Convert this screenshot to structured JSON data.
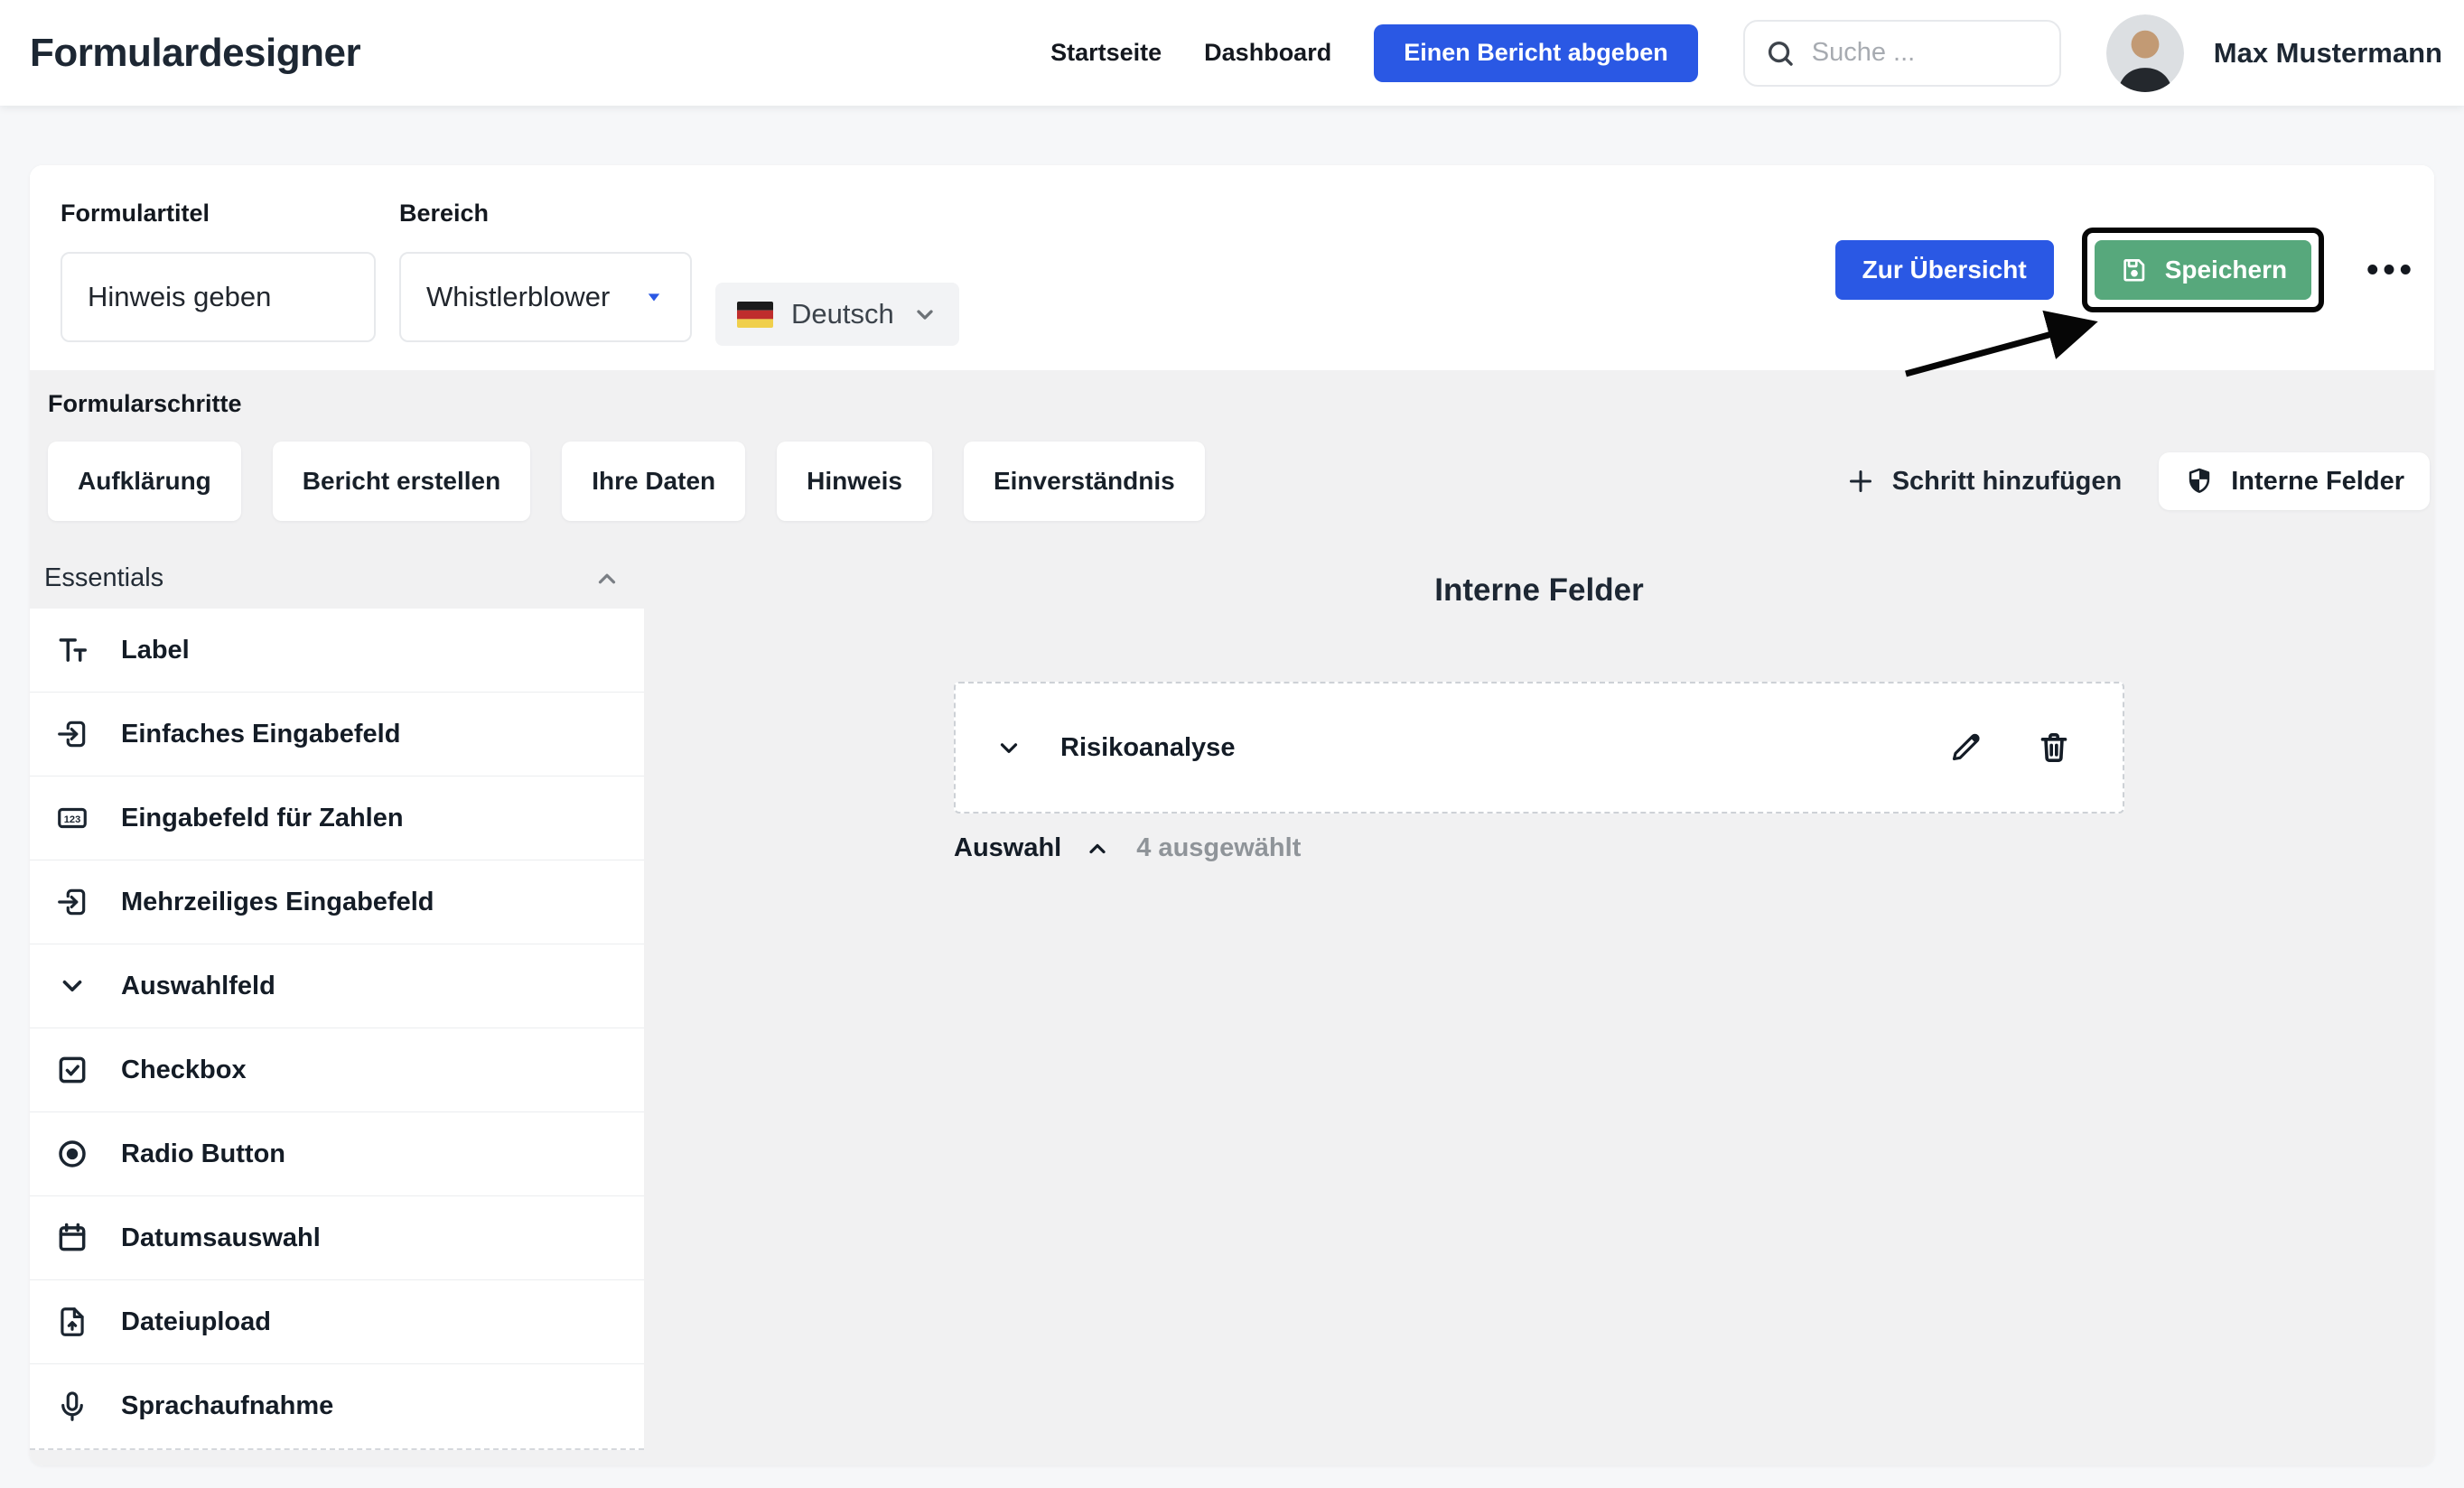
{
  "header": {
    "app_title": "Formulardesigner",
    "nav": [
      "Startseite",
      "Dashboard"
    ],
    "report_button_label": "Einen Bericht abgeben",
    "search_placeholder": "Suche ...",
    "user_name": "Max Mustermann"
  },
  "toolbar": {
    "form_title_label": "Formulartitel",
    "form_title_value": "Hinweis geben",
    "area_label": "Bereich",
    "area_value": "Whistlerblower",
    "language_value": "Deutsch",
    "language_flag": "german-flag",
    "overview_button_label": "Zur Übersicht",
    "save_button_label": "Speichern",
    "more_menu_label": "•••"
  },
  "steps": {
    "section_label": "Formularschritte",
    "items": [
      "Aufklärung",
      "Bericht erstellen",
      "Ihre Daten",
      "Hinweis",
      "Einverständnis"
    ],
    "add_step_label": "Schritt hinzufügen",
    "internal_fields_button_label": "Interne Felder"
  },
  "palette": {
    "group_label": "Essentials",
    "items": [
      {
        "icon": "typography-icon",
        "label": "Label"
      },
      {
        "icon": "input-icon",
        "label": "Einfaches Eingabefeld"
      },
      {
        "icon": "number-input-icon",
        "label": "Eingabefeld für Zahlen"
      },
      {
        "icon": "multiline-input-icon",
        "label": "Mehrzeiliges Eingabefeld"
      },
      {
        "icon": "chevron-down-icon",
        "label": "Auswahlfeld"
      },
      {
        "icon": "checkbox-icon",
        "label": "Checkbox"
      },
      {
        "icon": "radio-icon",
        "label": "Radio Button"
      },
      {
        "icon": "calendar-icon",
        "label": "Datumsauswahl"
      },
      {
        "icon": "file-upload-icon",
        "label": "Dateiupload"
      },
      {
        "icon": "microphone-icon",
        "label": "Sprachaufnahme"
      }
    ]
  },
  "canvas": {
    "title": "Interne Felder",
    "field_group": {
      "label": "Risikoanalyse"
    },
    "selection": {
      "label": "Auswahl",
      "count_text": "4 ausgewählt"
    }
  },
  "colors": {
    "primary_blue": "#2a58e4",
    "save_green": "#57a87c",
    "text_dark": "#1e2833",
    "muted_gray": "#8f9499",
    "section_bg": "#f1f1f2",
    "flag_black": "#1c1c1c",
    "flag_red": "#bf2d2d",
    "flag_gold": "#f0cf4c"
  }
}
